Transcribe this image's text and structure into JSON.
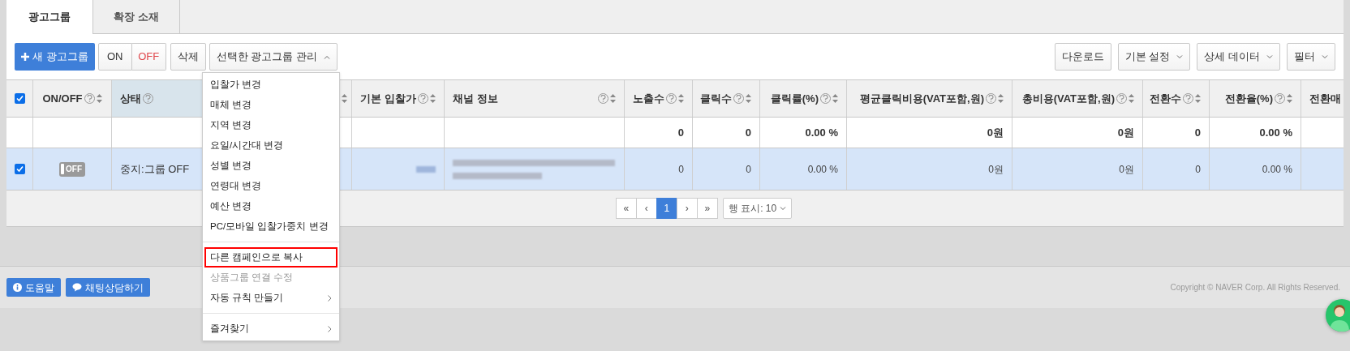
{
  "tabs": [
    {
      "label": "광고그룹",
      "selected": true
    },
    {
      "label": "확장 소재",
      "selected": false
    }
  ],
  "toolbar": {
    "new_button": "새 광고그룹",
    "on_button": "ON",
    "off_button": "OFF",
    "delete_button": "삭제",
    "manage_dropdown": {
      "label": "선택한 광고그룹 관리",
      "expanded": true
    },
    "right_buttons": [
      {
        "label": "다운로드",
        "dropdown": false
      },
      {
        "label": "기본 설정",
        "dropdown": true
      },
      {
        "label": "상세 데이터",
        "dropdown": true
      },
      {
        "label": "필터",
        "dropdown": true
      }
    ]
  },
  "table": {
    "select_all": {
      "checked": true
    },
    "columns": [
      {
        "label": "ON/OFF",
        "help": true,
        "sort": true,
        "selected": false
      },
      {
        "label": "상태",
        "help": true,
        "sort": false,
        "selected": true
      },
      {
        "help": false,
        "sort": true,
        "selected": false
      },
      {
        "label": "기본 입찰가",
        "help": true,
        "sort": true,
        "selected": false
      },
      {
        "label": "채널 정보",
        "help": true,
        "sort": true,
        "selected": false
      },
      {
        "label": "노출수",
        "help": true,
        "sort": true,
        "selected": false
      },
      {
        "label": "클릭수",
        "help": true,
        "sort": true,
        "selected": false
      },
      {
        "label": "클릭률(%)",
        "help": true,
        "sort": true,
        "selected": false
      },
      {
        "label": "평균클릭비용(VAT포함,원)",
        "help": true,
        "sort": true,
        "selected": false
      },
      {
        "label": "총비용(VAT포함,원)",
        "help": true,
        "sort": true,
        "selected": false
      },
      {
        "label": "전환수",
        "help": true,
        "sort": true,
        "selected": false
      },
      {
        "label": "전환율(%)",
        "help": true,
        "sort": true,
        "selected": false
      },
      {
        "label": "전환매",
        "selected": false
      }
    ],
    "total_row": {
      "values": [
        "0",
        "0",
        "0.00 %",
        "0원",
        "0원",
        "0",
        "0.00 %"
      ]
    },
    "rows": [
      {
        "checked": true,
        "toggle": {
          "on": false,
          "label": "OFF"
        },
        "status": "중지:그룹 OFF",
        "values": [
          "0",
          "0",
          "0.00 %",
          "0원",
          "0원",
          "0",
          "0.00 %"
        ]
      }
    ]
  },
  "pagination": {
    "first": "«",
    "prev": "‹",
    "pages": [
      {
        "label": "1",
        "selected": true
      }
    ],
    "next": "›",
    "last": "»",
    "rows_per_page": "행 표시: 10"
  },
  "menu": {
    "items": [
      {
        "label": "입찰가 변경",
        "kind": "item",
        "disabled": false,
        "highlighted": false,
        "submenu": false
      },
      {
        "label": "매체 변경",
        "kind": "item",
        "disabled": false,
        "highlighted": false,
        "submenu": false
      },
      {
        "label": "지역 변경",
        "kind": "item",
        "disabled": false,
        "highlighted": false,
        "submenu": false
      },
      {
        "label": "요일/시간대 변경",
        "kind": "item",
        "disabled": false,
        "highlighted": false,
        "submenu": false
      },
      {
        "label": "성별 변경",
        "kind": "item",
        "disabled": false,
        "highlighted": false,
        "submenu": false
      },
      {
        "label": "연령대 변경",
        "kind": "item",
        "disabled": false,
        "highlighted": false,
        "submenu": false
      },
      {
        "label": "예산 변경",
        "kind": "item",
        "disabled": false,
        "highlighted": false,
        "submenu": false
      },
      {
        "label": "PC/모바일 입찰가중치 변경",
        "kind": "item",
        "disabled": false,
        "highlighted": false,
        "submenu": false
      },
      {
        "kind": "divider"
      },
      {
        "label": "다른 캠페인으로 복사",
        "kind": "item",
        "disabled": false,
        "highlighted": true,
        "submenu": false
      },
      {
        "label": "상품그룹 연결 수정",
        "kind": "item",
        "disabled": true,
        "highlighted": false,
        "submenu": false
      },
      {
        "label": "자동 규칙 만들기",
        "kind": "item",
        "disabled": false,
        "highlighted": false,
        "submenu": true
      },
      {
        "kind": "divider"
      },
      {
        "label": "즐겨찾기",
        "kind": "item",
        "disabled": false,
        "highlighted": false,
        "submenu": true
      }
    ]
  },
  "footer": {
    "help_button": "도움말",
    "chat_button": "채팅상담하기",
    "copyright": "Copyright © NAVER Corp. All Rights Reserved."
  }
}
